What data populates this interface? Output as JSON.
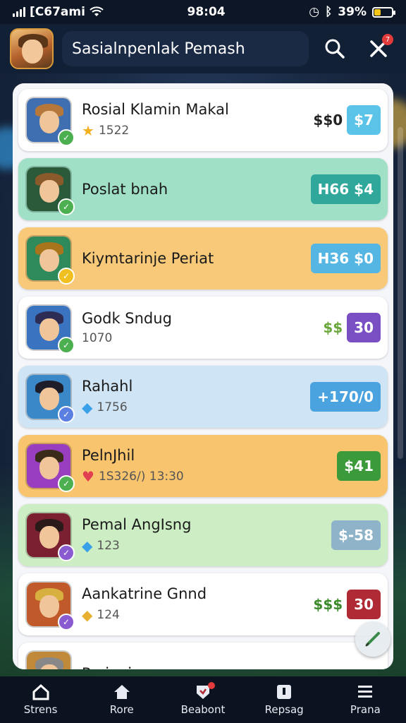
{
  "status_bar": {
    "carrier": "[C67ami",
    "time": "98:04",
    "battery": "39%",
    "battery_level": 0.39
  },
  "header": {
    "title": "Sasialnpenlak Pemash",
    "notification_count": "7"
  },
  "items": [
    {
      "name": "Rosial Klamin Makal",
      "sub": "1522",
      "prefix": "$$0",
      "price": "$7",
      "bg": "#ffffff",
      "tag_color": "#5bc3e8",
      "prefix_color": "#222",
      "sub_icon": "star"
    },
    {
      "name": "Poslat bnah",
      "sub": "",
      "prefix": "",
      "price": "H66 $4",
      "bg": "#9fe0c6",
      "tag_color": "#2fa79a",
      "prefix_color": "#222",
      "sub_icon": ""
    },
    {
      "name": "Kiymtarinje Periat",
      "sub": "",
      "prefix": "",
      "price": "H36 $0",
      "bg": "#f7c978",
      "tag_color": "#56b6e3",
      "prefix_color": "#222",
      "sub_icon": ""
    },
    {
      "name": "Godk Sndug",
      "sub": "1070",
      "prefix": "$$",
      "price": "30",
      "bg": "#ffffff",
      "tag_color": "#7b4fc4",
      "prefix_color": "#6aa63a",
      "sub_icon": ""
    },
    {
      "name": "Rahahl",
      "sub": "1756",
      "prefix": "",
      "price": "+170/0",
      "bg": "#cfe4f5",
      "tag_color": "#4aa3df",
      "prefix_color": "#222",
      "sub_icon": "gem"
    },
    {
      "name": "PelnJhil",
      "sub": "1S326/) 13:30",
      "prefix": "",
      "price": "$41",
      "bg": "#f8c46e",
      "tag_color": "#3b9a3a",
      "prefix_color": "#222",
      "sub_icon": "heart"
    },
    {
      "name": "Pemal AngIsng",
      "sub": "123",
      "prefix": "",
      "price": "$-58",
      "bg": "#cdeec4",
      "tag_color": "#8fb3c9",
      "prefix_color": "#222",
      "sub_icon": "gem"
    },
    {
      "name": "Aankatrine Gnnd",
      "sub": "124",
      "prefix": "$$$",
      "price": "30",
      "bg": "#ffffff",
      "tag_color": "#b02a35",
      "prefix_color": "#3a8a2a",
      "sub_icon": "shield"
    },
    {
      "name": "Parinain",
      "sub": "",
      "prefix": "",
      "price": "",
      "bg": "#ffffff",
      "tag_color": "#cccccc",
      "prefix_color": "#222",
      "sub_icon": ""
    }
  ],
  "nav": [
    {
      "label": "Strens",
      "icon": "home-icon"
    },
    {
      "label": "Rore",
      "icon": "house-icon"
    },
    {
      "label": "Beabont",
      "icon": "shield-icon"
    },
    {
      "label": "Repsag",
      "icon": "info-icon"
    },
    {
      "label": "Prana",
      "icon": "menu-icon"
    }
  ]
}
